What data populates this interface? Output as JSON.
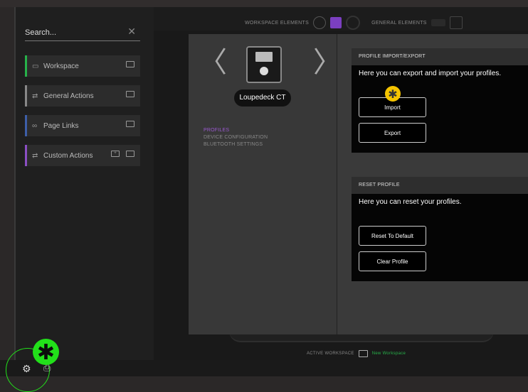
{
  "sidebar": {
    "search_placeholder": "Search...",
    "items": [
      {
        "label": "Workspace",
        "accent": "#27b24a",
        "icon": "monitor-icon"
      },
      {
        "label": "General Actions",
        "accent": "#888888",
        "icon": "swap-icon"
      },
      {
        "label": "Page Links",
        "accent": "#3d5ea8",
        "icon": "link-icon"
      },
      {
        "label": "Custom Actions",
        "accent": "#8b4fc4",
        "icon": "swap-icon"
      }
    ]
  },
  "topnav": {
    "workspace_elements": "WORKSPACE ELEMENTS",
    "general_elements": "GENERAL ELEMENTS"
  },
  "device": {
    "name": "Loupedeck CT",
    "menu": [
      "PROFILES",
      "DEVICE CONFIGURATION",
      "BLUETOOTH SETTINGS"
    ]
  },
  "import_export": {
    "title": "PROFILE IMPORT/EXPORT",
    "description": "Here you can export and import your profiles.",
    "import_label": "Import",
    "export_label": "Export"
  },
  "reset": {
    "title": "RESET PROFILE",
    "description": "Here you can reset your profiles.",
    "reset_label": "Reset To Default",
    "clear_label": "Clear Profile"
  },
  "footer": {
    "active_workspace_label": "ACTIVE WORKSPACE",
    "workspace_name": "New Workspace"
  },
  "colors": {
    "accent_purple": "#9b59d0",
    "accent_green": "#27b24a",
    "highlight_yellow": "#f5c400",
    "highlight_green": "#22e01a"
  }
}
